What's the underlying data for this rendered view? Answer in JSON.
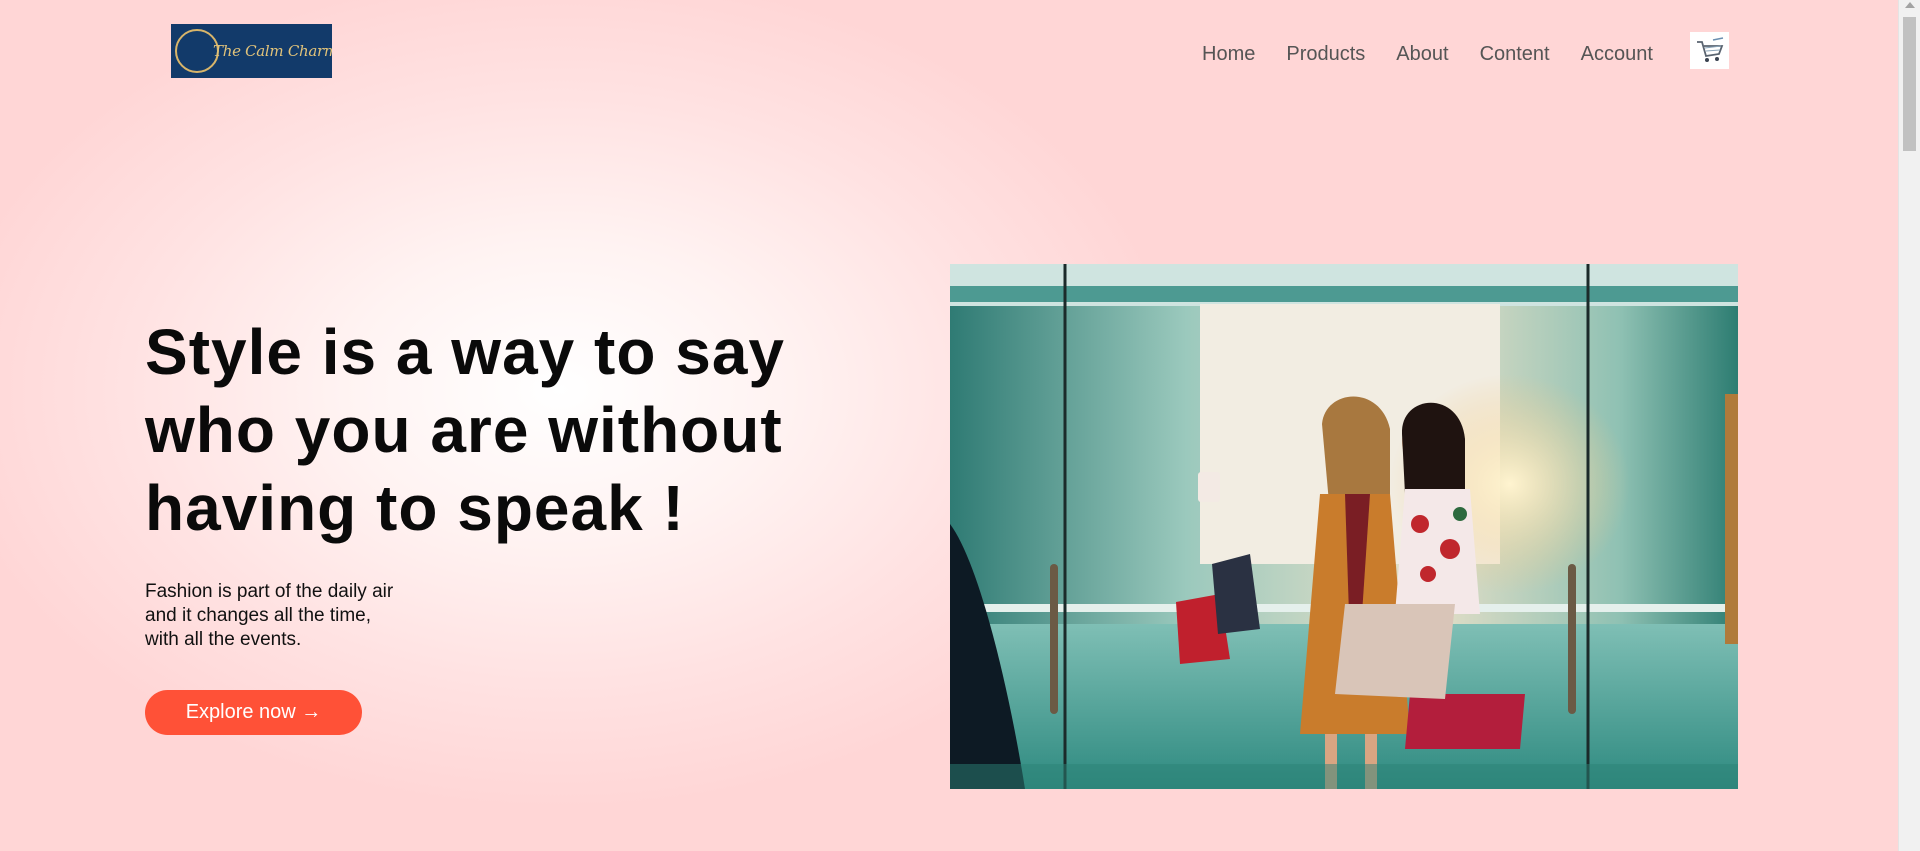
{
  "brand": {
    "logo_text": "The Calm Charm"
  },
  "nav": {
    "items": [
      {
        "label": "Home"
      },
      {
        "label": "Products"
      },
      {
        "label": "About"
      },
      {
        "label": "Content"
      },
      {
        "label": "Account"
      }
    ],
    "cart_icon": "cart-icon"
  },
  "hero": {
    "headline": [
      "Style is a way to say",
      "who you are without",
      "having to speak !"
    ],
    "subtext": [
      "Fashion is part of the daily air",
      "and it changes all the time,",
      "with all the events."
    ],
    "cta_label": "Explore now →",
    "cta_color": "#ff5137",
    "image_subject": "two-women-shopping-photo"
  }
}
